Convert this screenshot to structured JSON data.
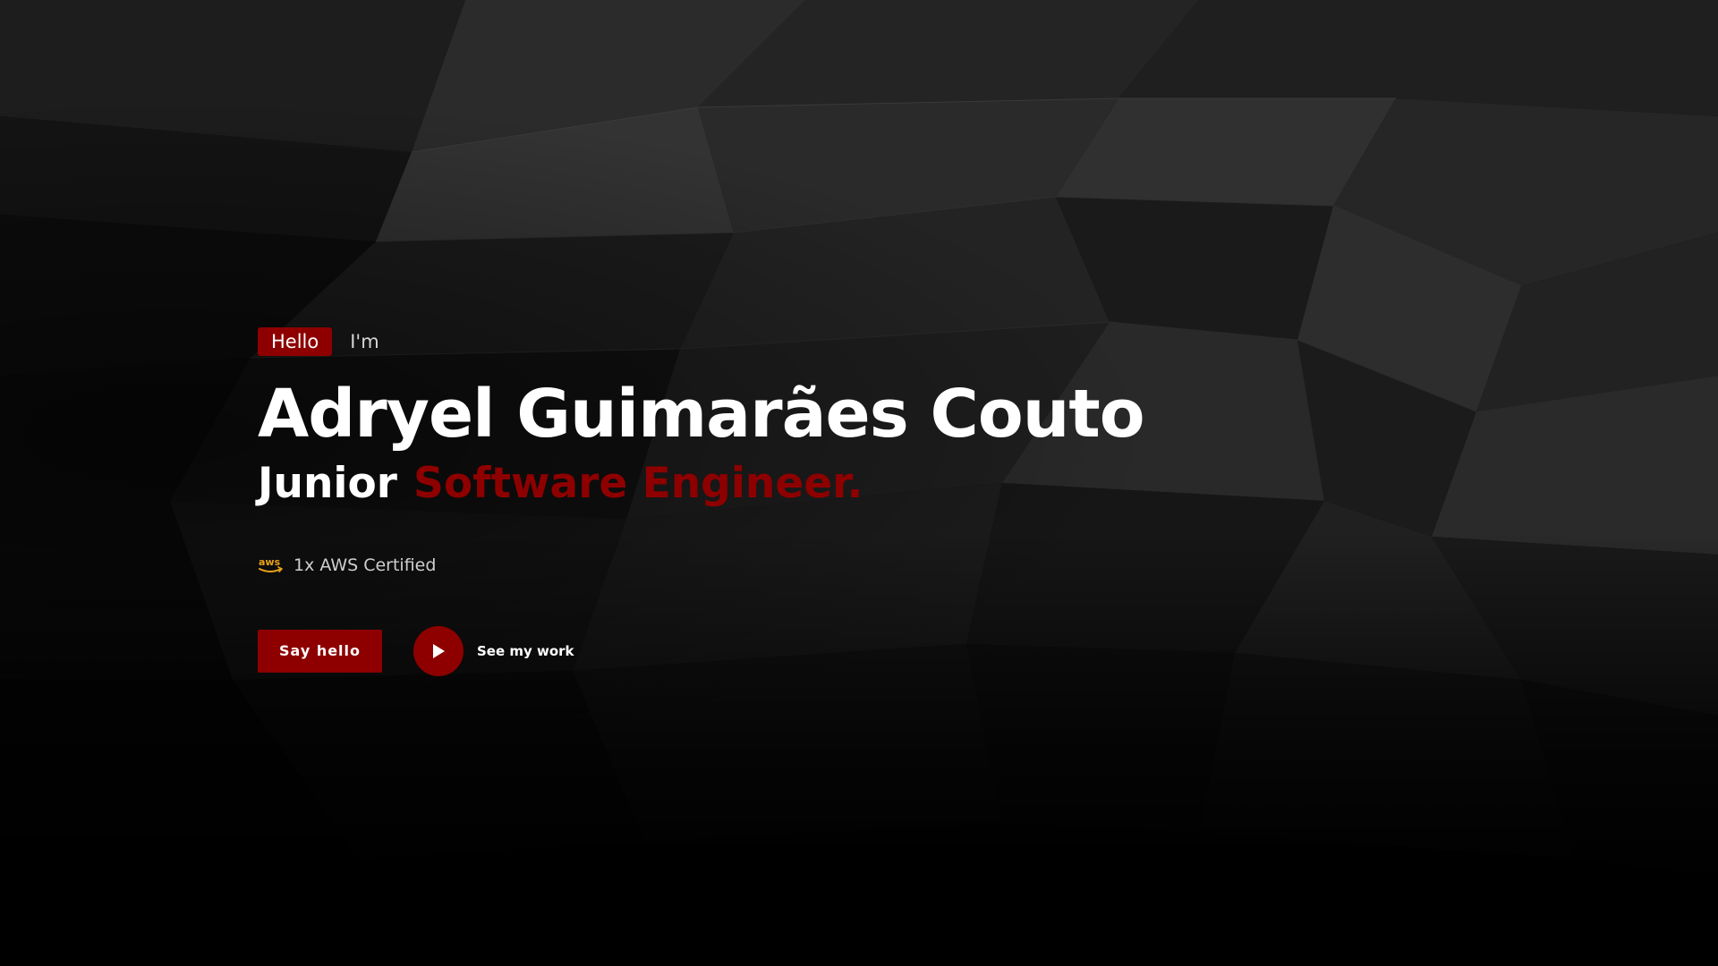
{
  "hero": {
    "badge": "Hello",
    "intro": "I'm",
    "name": "Adryel Guimarães Couto",
    "role_level": "Junior",
    "role_title": "Software Engineer.",
    "cert_icon": "aws-logo-icon",
    "cert_text": "1x AWS Certified",
    "primary_button": "Say hello",
    "secondary_link": "See my work",
    "secondary_icon": "play-icon"
  },
  "colors": {
    "accent": "#8e0000",
    "background": "#050505",
    "text_primary": "#ffffff",
    "text_secondary": "#cfcfcf"
  }
}
